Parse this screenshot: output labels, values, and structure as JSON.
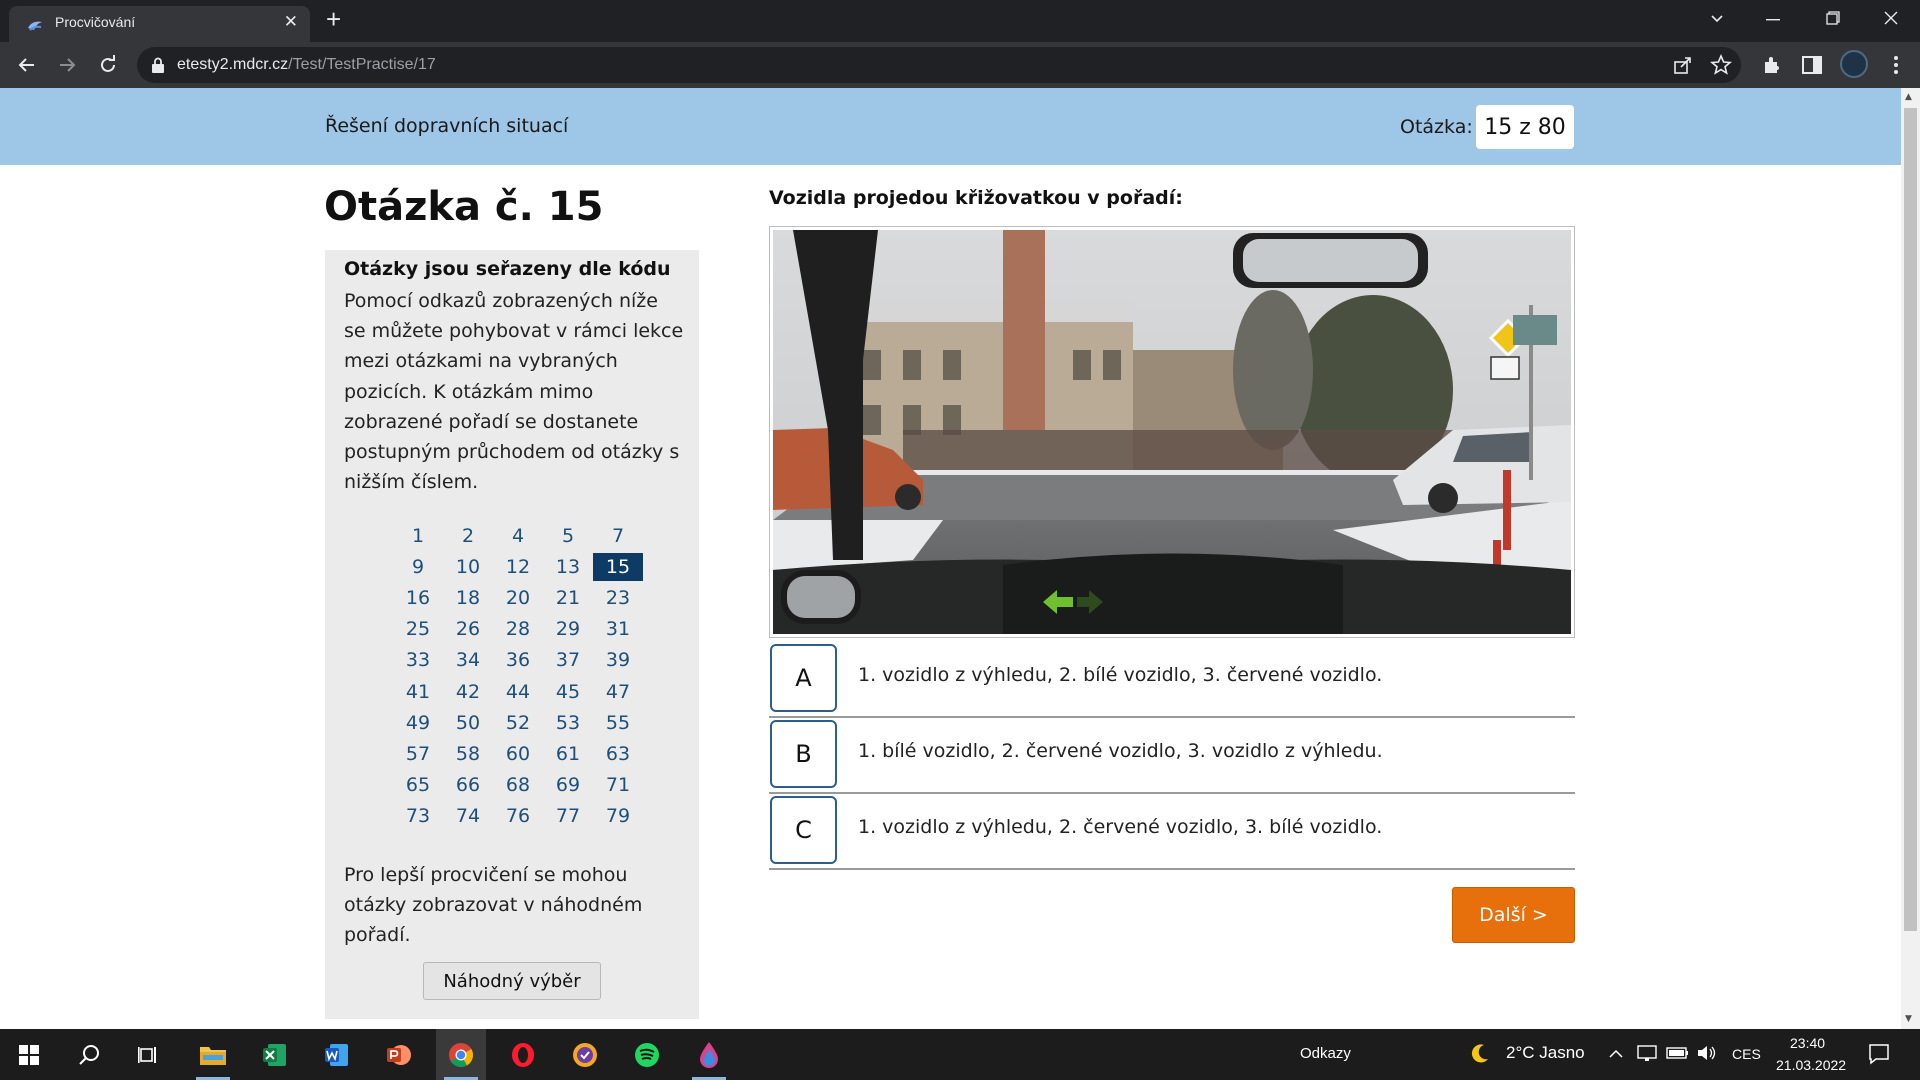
{
  "browser": {
    "tab_title": "Procvičování",
    "new_tab_symbol": "+",
    "tab_close_symbol": "✕",
    "url_host": "etesty2.mdcr.cz",
    "url_path": "/Test/TestPractise/17",
    "icons": [
      "back-icon",
      "forward-icon",
      "reload-icon",
      "lock-icon",
      "share-icon",
      "star-icon",
      "extensions-icon",
      "sidepanel-icon",
      "profile-avatar",
      "menu-icon"
    ]
  },
  "header": {
    "section_title": "Řešení dopravních situací",
    "counter_label": "Otázka:",
    "counter_value": "15 z 80"
  },
  "question": {
    "heading": "Otázka č. 15",
    "text": "Vozidla projedou křižovatkou v pořadí:"
  },
  "sidebar": {
    "title": "Otázky jsou seřazeny dle kódu",
    "description": "Pomocí odkazů zobrazených níže se můžete pohybovat v rámci lekce mezi otázkami na vybraných pozicích. K otázkám mimo zobrazené pořadí se dostanete postupným průchodem od otázky s nižším číslem.",
    "question_links": [
      [
        "1",
        "2",
        "4",
        "5",
        "7"
      ],
      [
        "9",
        "10",
        "12",
        "13",
        "15"
      ],
      [
        "16",
        "18",
        "20",
        "21",
        "23"
      ],
      [
        "25",
        "26",
        "28",
        "29",
        "31"
      ],
      [
        "33",
        "34",
        "36",
        "37",
        "39"
      ],
      [
        "41",
        "42",
        "44",
        "45",
        "47"
      ],
      [
        "49",
        "50",
        "52",
        "53",
        "55"
      ],
      [
        "57",
        "58",
        "60",
        "61",
        "63"
      ],
      [
        "65",
        "66",
        "68",
        "69",
        "71"
      ],
      [
        "73",
        "74",
        "76",
        "77",
        "79"
      ]
    ],
    "active_question": "15",
    "random_text": "Pro lepší procvičení se mohou otázky zobrazovat v náhodném pořadí.",
    "random_button": "Náhodný výběr"
  },
  "answers": [
    {
      "letter": "A",
      "text": "1. vozidlo z výhledu, 2. bílé vozidlo, 3. červené vozidlo."
    },
    {
      "letter": "B",
      "text": "1. bílé vozidlo, 2. červené vozidlo, 3. vozidlo z výhledu."
    },
    {
      "letter": "C",
      "text": "1. vozidlo z výhledu, 2. červené vozidlo, 3. bílé vozidlo."
    }
  ],
  "next_button": "Další >",
  "taskbar": {
    "apps": [
      "windows-start-icon",
      "search-icon",
      "task-view-icon",
      "file-explorer-icon",
      "excel-icon",
      "word-icon",
      "powerpoint-icon",
      "chrome-icon",
      "opera-icon",
      "brave-icon",
      "spotify-icon",
      "paint-drop-icon"
    ],
    "active_app": "chrome-icon",
    "links_label": "Odkazy",
    "weather": "2°C  Jasno",
    "language": "CES",
    "time": "23:40",
    "date": "21.03.2022"
  },
  "colors": {
    "header_bg": "#9ec6e6",
    "active_link_bg": "#0d3b66",
    "next_button_bg": "#e8700c",
    "answer_border": "#2c5f8a"
  }
}
